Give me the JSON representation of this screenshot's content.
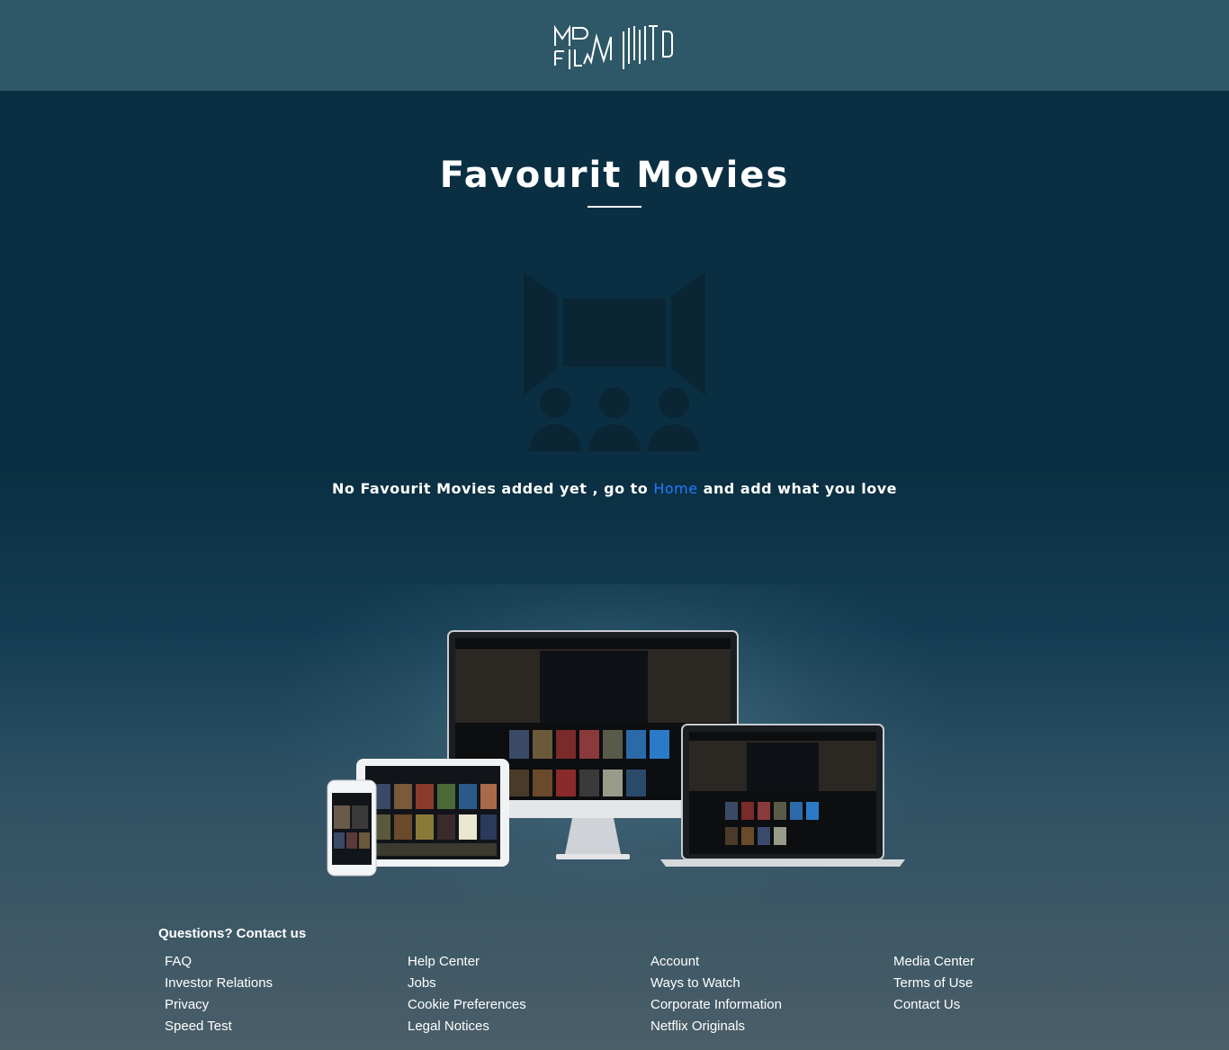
{
  "header": {
    "logo_icon": "momento-film-logo-icon"
  },
  "page": {
    "title": "Favourit Movies",
    "empty_icon": "cinema-audience-icon",
    "empty_message_prefix": "No Favourit Movies added yet , go to ",
    "empty_message_link": "Home",
    "empty_message_suffix": " and add what you love",
    "link_color": "#1e7bff"
  },
  "devices_image": "multi-device-streaming-image",
  "footer": {
    "heading": "Questions? Contact us",
    "columns": [
      [
        "FAQ",
        "Investor Relations",
        "Privacy",
        "Speed Test"
      ],
      [
        "Help Center",
        "Jobs",
        "Cookie Preferences",
        "Legal Notices"
      ],
      [
        "Account",
        "Ways to Watch",
        "Corporate Information",
        "Netflix Originals"
      ],
      [
        "Media Center",
        "Terms of Use",
        "Contact Us"
      ]
    ]
  },
  "colors": {
    "header_bg": "#2e5868",
    "page_bg": "#0b2f42",
    "footer_bg": "#4a5e68"
  }
}
